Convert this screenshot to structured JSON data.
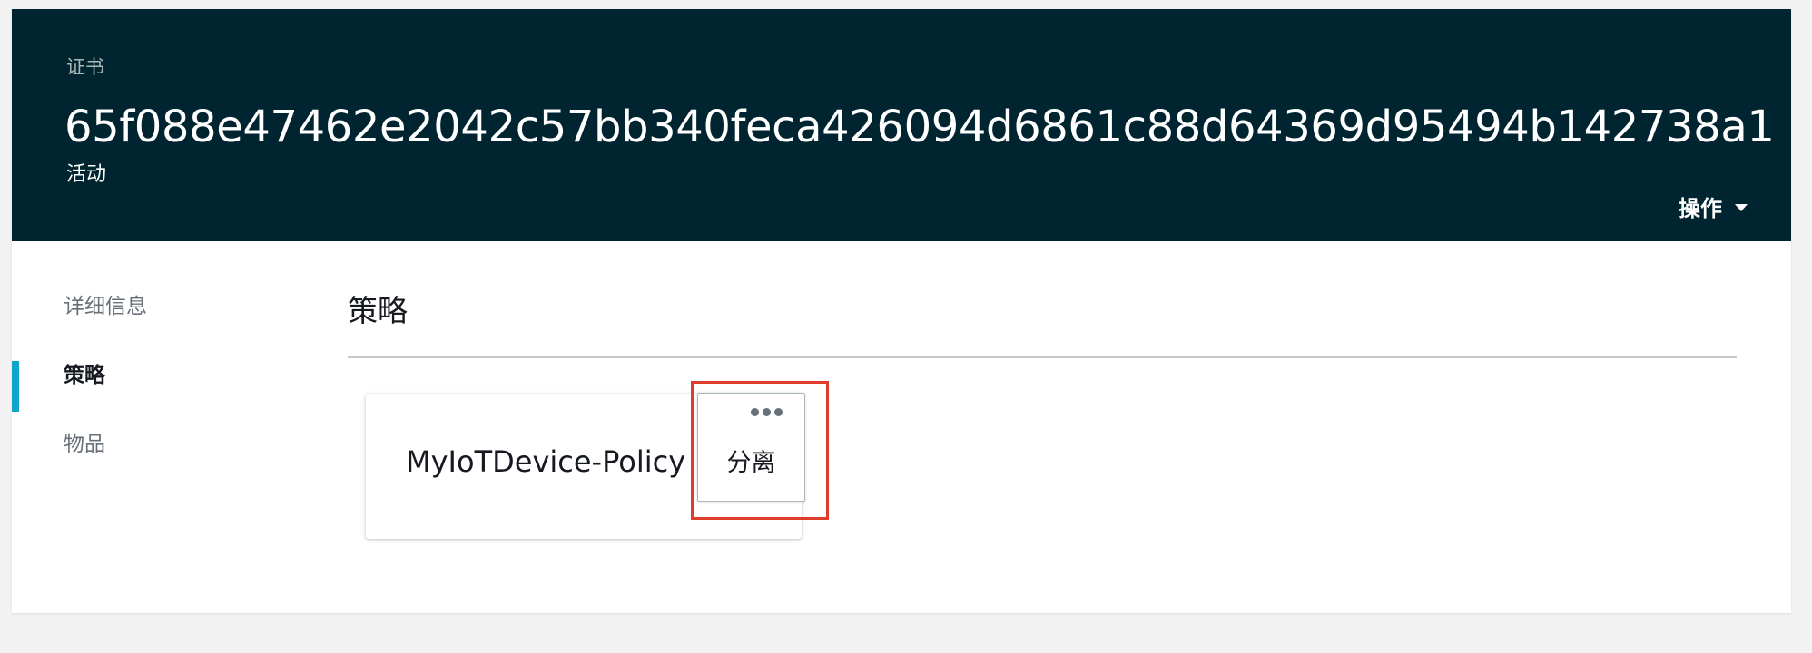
{
  "header": {
    "label": "证书",
    "title": "65f088e47462e2042c57bb340feca426094d6861c88d64369d95494b142738a1",
    "status": "活动",
    "actions_label": "操作"
  },
  "sidebar": {
    "items": [
      {
        "label": "详细信息",
        "active": false
      },
      {
        "label": "策略",
        "active": true
      },
      {
        "label": "物品",
        "active": false
      }
    ]
  },
  "main": {
    "section_title": "策略",
    "policy_card": {
      "name": "MyIoTDevice-Policy",
      "menu": {
        "icon": "more-dots-icon",
        "items": [
          {
            "label": "分离"
          }
        ]
      }
    }
  },
  "colors": {
    "header_bg": "#012530",
    "active_indicator": "#0ea5c8",
    "highlight": "#e03c2c"
  }
}
